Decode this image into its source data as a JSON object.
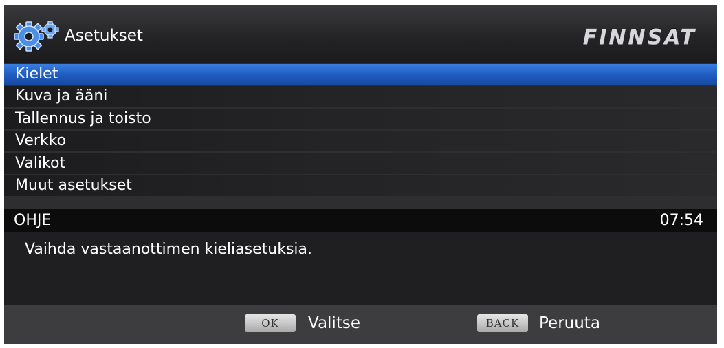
{
  "header": {
    "title": "Asetukset",
    "brand": "FINNSAT",
    "icon": "gear-icon"
  },
  "menu": {
    "items": [
      {
        "label": "Kielet",
        "selected": true
      },
      {
        "label": "Kuva ja ääni",
        "selected": false
      },
      {
        "label": "Tallennus ja toisto",
        "selected": false
      },
      {
        "label": "Verkko",
        "selected": false
      },
      {
        "label": "Valikot",
        "selected": false
      },
      {
        "label": "Muut asetukset",
        "selected": false
      }
    ]
  },
  "help": {
    "title": "OHJE",
    "time": "07:54",
    "text": "Vaihda vastaanottimen kieliasetuksia."
  },
  "footer": {
    "ok_key": "OK",
    "ok_label": "Valitse",
    "back_key": "BACK",
    "back_label": "Peruuta"
  },
  "colors": {
    "selection": "#1f5fc2",
    "background": "#2e2e30",
    "text": "#ffffff"
  }
}
